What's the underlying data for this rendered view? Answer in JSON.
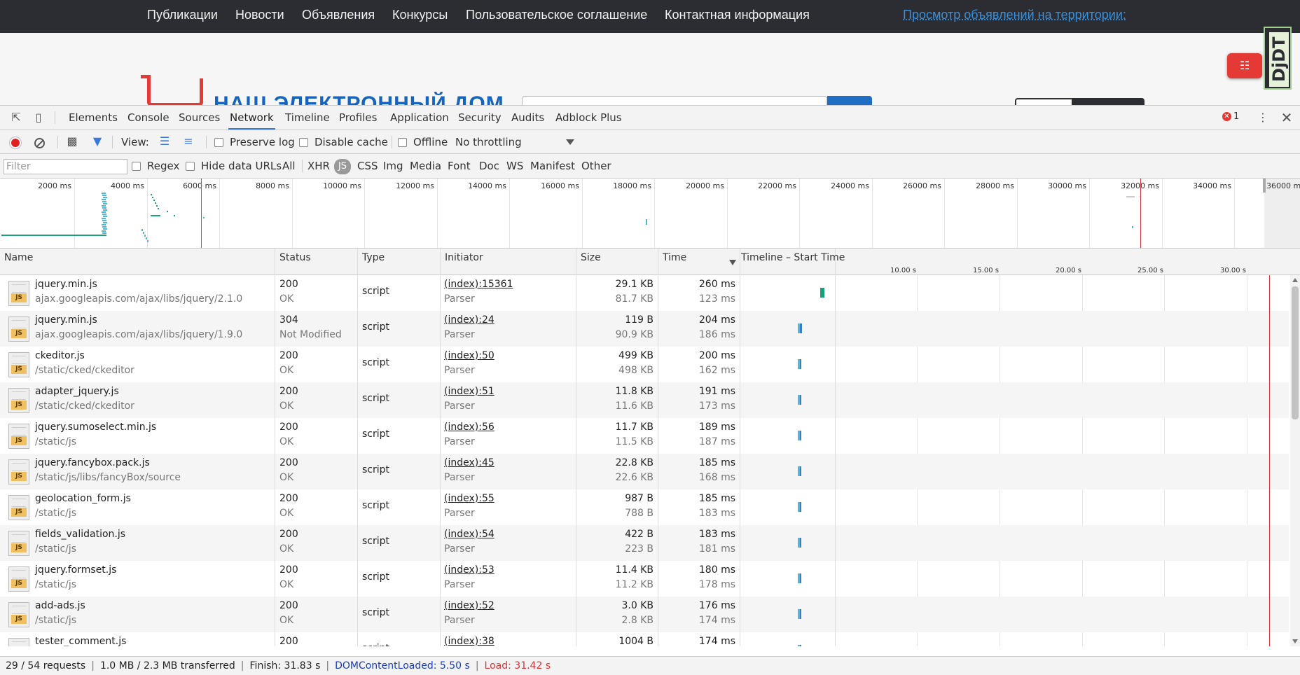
{
  "site": {
    "nav_items": [
      "Публикации",
      "Новости",
      "Объявления",
      "Конкурсы",
      "Пользовательское соглашение",
      "Контактная информация"
    ],
    "nav_link": "Просмотр объявлений на территории:",
    "logo_text": "НАШ ЭЛЕКТРОННЫЙ ДОМ",
    "djdt_label": "DjDT",
    "pdf_icon": "pdf-icon"
  },
  "devtools": {
    "tabs": [
      "Elements",
      "Console",
      "Sources",
      "Network",
      "Timeline",
      "Profiles",
      "Application",
      "Security",
      "Audits",
      "Adblock Plus"
    ],
    "active_tab": "Network",
    "error_count": "1",
    "toolbar": {
      "view_label": "View:",
      "preserve_log": "Preserve log",
      "disable_cache": "Disable cache",
      "offline": "Offline",
      "throttling": "No throttling"
    },
    "filterbar": {
      "placeholder": "Filter",
      "regex": "Regex",
      "hide_data_urls": "Hide data URLs",
      "types": [
        "All",
        "XHR",
        "JS",
        "CSS",
        "Img",
        "Media",
        "Font",
        "Doc",
        "WS",
        "Manifest",
        "Other"
      ],
      "active_type": "JS"
    },
    "overview_ticks": [
      "2000 ms",
      "4000 ms",
      "6000 ms",
      "8000 ms",
      "10000 ms",
      "12000 ms",
      "14000 ms",
      "16000 ms",
      "18000 ms",
      "20000 ms",
      "22000 ms",
      "24000 ms",
      "26000 ms",
      "28000 ms",
      "30000 ms",
      "32000 ms",
      "34000 ms",
      "36000 m"
    ],
    "columns": {
      "name": "Name",
      "status": "Status",
      "type": "Type",
      "initiator": "Initiator",
      "size": "Size",
      "time": "Time",
      "timeline": "Timeline – Start Time"
    },
    "timeline_ticks": [
      "10.00 s",
      "15.00 s",
      "20.00 s",
      "25.00 s",
      "30.00 s"
    ],
    "rows": [
      {
        "name": "jquery.min.js",
        "path": "ajax.googleapis.com/ajax/libs/jquery/2.1.0",
        "status": "200",
        "status_text": "OK",
        "type": "script",
        "initiator": "(index):15361",
        "initiator_type": "Parser",
        "size": "29.1 KB",
        "content": "81.7 KB",
        "time": "260 ms",
        "latency": "123 ms",
        "bar": "green"
      },
      {
        "name": "jquery.min.js",
        "path": "ajax.googleapis.com/ajax/libs/jquery/1.9.0",
        "status": "304",
        "status_text": "Not Modified",
        "type": "script",
        "initiator": "(index):24",
        "initiator_type": "Parser",
        "size": "119 B",
        "content": "90.9 KB",
        "time": "204 ms",
        "latency": "186 ms",
        "bar": "blue"
      },
      {
        "name": "ckeditor.js",
        "path": "/static/cked/ckeditor",
        "status": "200",
        "status_text": "OK",
        "type": "script",
        "initiator": "(index):50",
        "initiator_type": "Parser",
        "size": "499 KB",
        "content": "498 KB",
        "time": "200 ms",
        "latency": "162 ms",
        "bar": "blue"
      },
      {
        "name": "adapter_jquery.js",
        "path": "/static/cked/ckeditor",
        "status": "200",
        "status_text": "OK",
        "type": "script",
        "initiator": "(index):51",
        "initiator_type": "Parser",
        "size": "11.8 KB",
        "content": "11.6 KB",
        "time": "191 ms",
        "latency": "173 ms",
        "bar": "blue"
      },
      {
        "name": "jquery.sumoselect.min.js",
        "path": "/static/js",
        "status": "200",
        "status_text": "OK",
        "type": "script",
        "initiator": "(index):56",
        "initiator_type": "Parser",
        "size": "11.7 KB",
        "content": "11.5 KB",
        "time": "189 ms",
        "latency": "187 ms",
        "bar": "blue"
      },
      {
        "name": "jquery.fancybox.pack.js",
        "path": "/static/js/libs/fancyBox/source",
        "status": "200",
        "status_text": "OK",
        "type": "script",
        "initiator": "(index):45",
        "initiator_type": "Parser",
        "size": "22.8 KB",
        "content": "22.6 KB",
        "time": "185 ms",
        "latency": "168 ms",
        "bar": "blue"
      },
      {
        "name": "geolocation_form.js",
        "path": "/static/js",
        "status": "200",
        "status_text": "OK",
        "type": "script",
        "initiator": "(index):55",
        "initiator_type": "Parser",
        "size": "987 B",
        "content": "788 B",
        "time": "185 ms",
        "latency": "183 ms",
        "bar": "blue"
      },
      {
        "name": "fields_validation.js",
        "path": "/static/js",
        "status": "200",
        "status_text": "OK",
        "type": "script",
        "initiator": "(index):54",
        "initiator_type": "Parser",
        "size": "422 B",
        "content": "223 B",
        "time": "183 ms",
        "latency": "181 ms",
        "bar": "blue"
      },
      {
        "name": "jquery.formset.js",
        "path": "/static/js",
        "status": "200",
        "status_text": "OK",
        "type": "script",
        "initiator": "(index):53",
        "initiator_type": "Parser",
        "size": "11.4 KB",
        "content": "11.2 KB",
        "time": "180 ms",
        "latency": "178 ms",
        "bar": "blue"
      },
      {
        "name": "add-ads.js",
        "path": "/static/js",
        "status": "200",
        "status_text": "OK",
        "type": "script",
        "initiator": "(index):52",
        "initiator_type": "Parser",
        "size": "3.0 KB",
        "content": "2.8 KB",
        "time": "176 ms",
        "latency": "174 ms",
        "bar": "blue"
      },
      {
        "name": "tester_comment.js",
        "path": "",
        "status": "200",
        "status_text": "",
        "type": "script",
        "initiator": "(index):38",
        "initiator_type": "",
        "size": "1004 B",
        "content": "",
        "time": "174 ms",
        "latency": "",
        "bar": "blue"
      }
    ],
    "status": {
      "requests": "29 / 54 requests",
      "transferred": "1.0 MB / 2.3 MB transferred",
      "finish": "Finish: 31.83 s",
      "dom_content_loaded": "DOMContentLoaded: 5.50 s",
      "load": "Load: 31.42 s"
    }
  }
}
